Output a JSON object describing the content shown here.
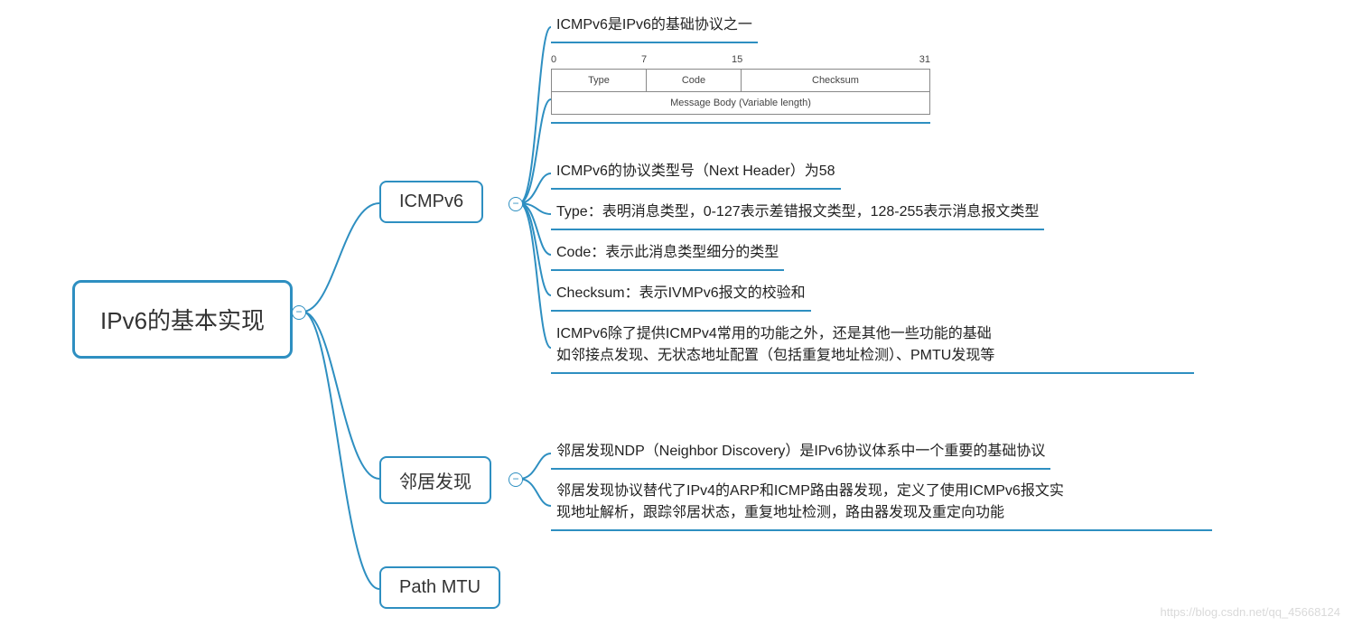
{
  "root": {
    "label": "IPv6的基本实现"
  },
  "branches": {
    "icmpv6": {
      "label": "ICMPv6"
    },
    "ndp": {
      "label": "邻居发现"
    },
    "pmtu": {
      "label": "Path MTU"
    }
  },
  "icmpv6_leaves": {
    "a": "ICMPv6是IPv6的基础协议之一",
    "c": "ICMPv6的协议类型号（Next Header）为58",
    "d": "Type：表明消息类型，0-127表示差错报文类型，128-255表示消息报文类型",
    "e": "Code：表示此消息类型细分的类型",
    "f": "Checksum：表示IVMPv6报文的校验和",
    "g_l1": "ICMPv6除了提供ICMPv4常用的功能之外，还是其他一些功能的基础",
    "g_l2": "如邻接点发现、无状态地址配置（包括重复地址检测）、PMTU发现等"
  },
  "ndp_leaves": {
    "a": "邻居发现NDP（Neighbor Discovery）是IPv6协议体系中一个重要的基础协议",
    "b_l1": "邻居发现协议替代了IPv4的ARP和ICMP路由器发现，定义了使用ICMPv6报文实",
    "b_l2": "现地址解析，跟踪邻居状态，重复地址检测，路由器发现及重定向功能"
  },
  "packet": {
    "bits": {
      "b0": "0",
      "b7": "7",
      "b15": "15",
      "b31": "31"
    },
    "type": "Type",
    "code": "Code",
    "checksum": "Checksum",
    "body": "Message Body (Variable length)"
  },
  "watermark": "https://blog.csdn.net/qq_45668124",
  "chart_data": {
    "type": "mindmap",
    "root": "IPv6的基本实现",
    "children": [
      {
        "label": "ICMPv6",
        "children": [
          "ICMPv6是IPv6的基础协议之一",
          {
            "packet_header": {
              "bit_markers": [
                0,
                7,
                15,
                31
              ],
              "row1": [
                "Type",
                "Code",
                "Checksum"
              ],
              "row2": "Message Body (Variable length)"
            }
          },
          "ICMPv6的协议类型号（Next Header）为58",
          "Type：表明消息类型，0-127表示差错报文类型，128-255表示消息报文类型",
          "Code：表示此消息类型细分的类型",
          "Checksum：表示IVMPv6报文的校验和",
          "ICMPv6除了提供ICMPv4常用的功能之外，还是其他一些功能的基础 如邻接点发现、无状态地址配置（包括重复地址检测）、PMTU发现等"
        ]
      },
      {
        "label": "邻居发现",
        "children": [
          "邻居发现NDP（Neighbor Discovery）是IPv6协议体系中一个重要的基础协议",
          "邻居发现协议替代了IPv4的ARP和ICMP路由器发现，定义了使用ICMPv6报文实现地址解析，跟踪邻居状态，重复地址检测，路由器发现及重定向功能"
        ]
      },
      {
        "label": "Path MTU",
        "children": []
      }
    ]
  }
}
